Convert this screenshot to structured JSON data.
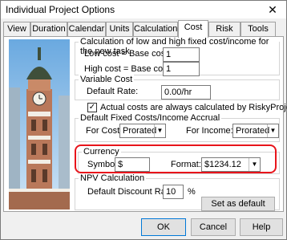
{
  "window": {
    "title": "Individual Project Options",
    "close_glyph": "✕"
  },
  "tabs": [
    {
      "label": "View"
    },
    {
      "label": "Duration"
    },
    {
      "label": "Calendar"
    },
    {
      "label": "Units"
    },
    {
      "label": "Calculation"
    },
    {
      "label": "Cost",
      "active": true
    },
    {
      "label": "Risk"
    },
    {
      "label": "Tools"
    }
  ],
  "fixed_cost": {
    "title": "Calculation of low and high fixed cost/income for the new task",
    "low_label": "Low cost = Base cost *",
    "low_value": "1",
    "high_label": "High cost = Base cost *",
    "high_value": "1"
  },
  "variable_cost": {
    "title": "Variable Cost",
    "rate_label": "Default Rate:",
    "rate_value": "0.00/hr"
  },
  "actual_costs": {
    "label": "Actual costs are always calculated by RiskyProject",
    "checked": true
  },
  "accrual": {
    "title": "Default Fixed Costs/Income Accrual",
    "costs_label": "For Costs:",
    "costs_value": "Prorated",
    "income_label": "For Income:",
    "income_value": "Prorated"
  },
  "currency": {
    "title": "Currency",
    "symbol_label": "Symbol:",
    "symbol_value": "$",
    "format_label": "Format:",
    "format_value": "$1234.12",
    "highlight_color": "#e8141b"
  },
  "npv": {
    "title": "NPV Calculation",
    "rate_label": "Default Discount Rate:",
    "rate_value": "10",
    "unit": "%",
    "set_default_label": "Set as default"
  },
  "buttons": {
    "ok": "OK",
    "cancel": "Cancel",
    "help": "Help"
  }
}
